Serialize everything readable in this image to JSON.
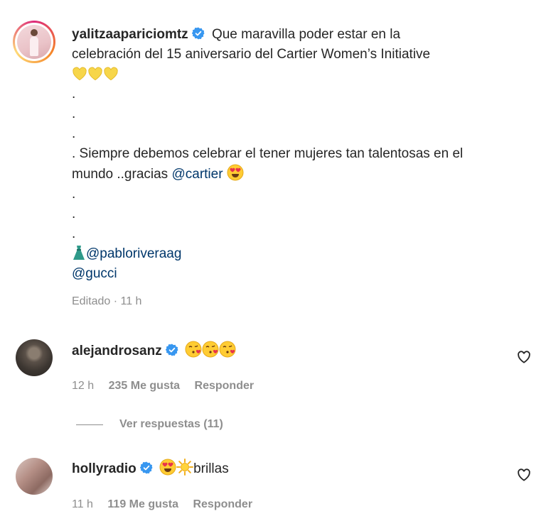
{
  "post": {
    "username": "yalitzaapariciomtz",
    "caption_line1": "Que maravilla poder estar en la",
    "caption_line2": "celebración del 15 aniversario del Cartier Women’s Initiative",
    "dot": ".",
    "line_siempre": ". Siempre debemos celebrar el tener mujeres tan talentosas en el",
    "line_mundo": "mundo ..gracias",
    "mention_cartier": "@cartier",
    "mention_pablo": "@pabloriveraag",
    "mention_gucci": "@gucci",
    "meta": "Editado · 11 h"
  },
  "comments": [
    {
      "username": "alejandrosanz",
      "text": "",
      "time": "12 h",
      "likes": "235 Me gusta",
      "reply": "Responder",
      "view_replies": "Ver respuestas (11)"
    },
    {
      "username": "hollyradio",
      "text": "brillas",
      "time": "11 h",
      "likes": "119 Me gusta",
      "reply": "Responder"
    }
  ],
  "icons": {
    "verified": "verified-badge-icon",
    "heart": "heart-outline-icon",
    "yellow_heart": "yellow-heart-emoji",
    "kiss": "face-blowing-kiss-emoji",
    "heart_eyes": "heart-eyes-emoji",
    "sun": "sun-emoji",
    "dress": "dress-emoji"
  },
  "colors": {
    "link": "#00376b",
    "verified": "#3897f0",
    "muted": "#8e8e8e",
    "ring_start": "#f58529",
    "ring_end": "#dd2a7b"
  }
}
